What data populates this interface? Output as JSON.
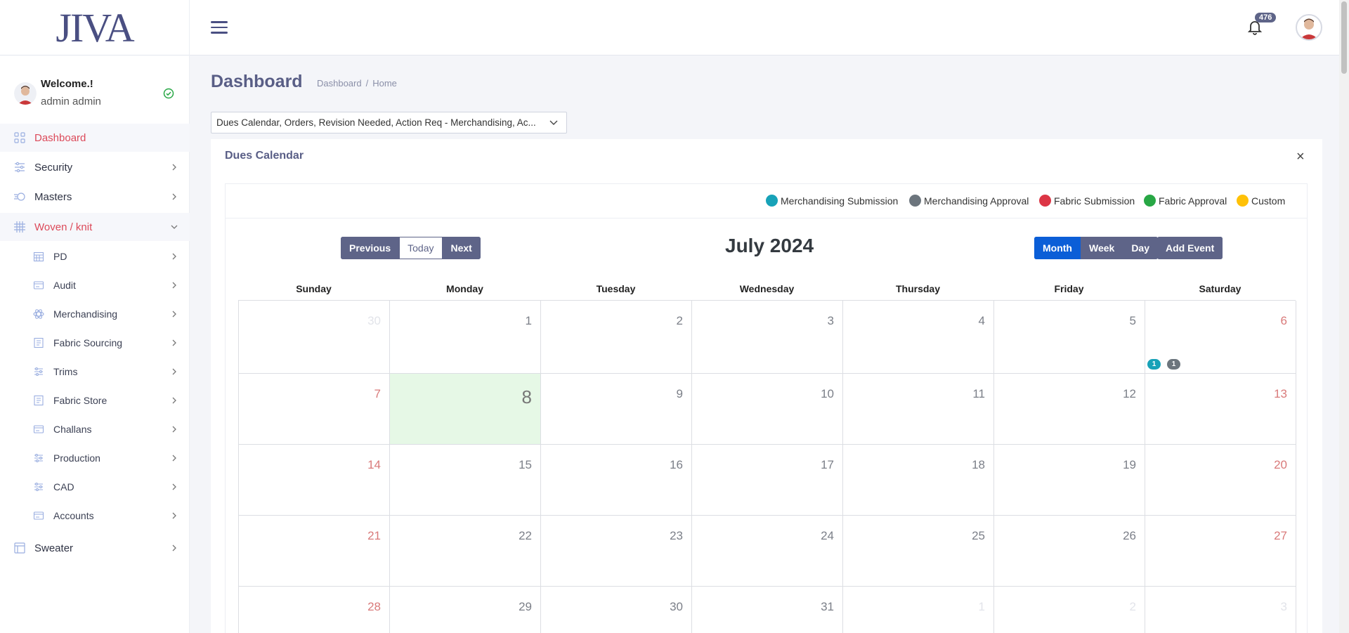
{
  "app": {
    "logo_text": "JIVA",
    "notifications_count": "476"
  },
  "sidebar": {
    "welcome": "Welcome.!",
    "user_name": "admin admin",
    "items": [
      {
        "label": "Dashboard",
        "icon": "grid-icon"
      },
      {
        "label": "Security",
        "icon": "sliders-icon"
      },
      {
        "label": "Masters",
        "icon": "speed-icon"
      },
      {
        "label": "Woven / knit",
        "icon": "hash-icon"
      },
      {
        "label": "Sweater",
        "icon": "layout-icon"
      }
    ],
    "sub_items": [
      {
        "label": "PD",
        "icon": "calendar-icon"
      },
      {
        "label": "Audit",
        "icon": "card-icon"
      },
      {
        "label": "Merchandising",
        "icon": "atom-icon"
      },
      {
        "label": "Fabric Sourcing",
        "icon": "document-icon"
      },
      {
        "label": "Trims",
        "icon": "sliders-icon"
      },
      {
        "label": "Fabric Store",
        "icon": "document-icon"
      },
      {
        "label": "Challans",
        "icon": "card-icon"
      },
      {
        "label": "Production",
        "icon": "sliders-icon"
      },
      {
        "label": "CAD",
        "icon": "sliders-icon"
      },
      {
        "label": "Accounts",
        "icon": "card-icon"
      }
    ]
  },
  "page": {
    "title": "Dashboard",
    "breadcrumb": [
      "Dashboard",
      "Home"
    ],
    "widget_select": "Dues Calendar, Orders, Revision Needed, Action Req - Merchandising, Ac..."
  },
  "card": {
    "title": "Dues Calendar",
    "close": "×"
  },
  "legend": [
    {
      "label": "Merchandising Submission",
      "color": "#17a2b8"
    },
    {
      "label": "Merchandising Approval",
      "color": "#6c757d"
    },
    {
      "label": "Fabric Submission",
      "color": "#dc3545"
    },
    {
      "label": "Fabric Approval",
      "color": "#28a745"
    },
    {
      "label": "Custom",
      "color": "#ffc107"
    }
  ],
  "calendar": {
    "nav": [
      "Previous",
      "Today",
      "Next"
    ],
    "views": [
      "Month",
      "Week",
      "Day"
    ],
    "add_event": "Add Event",
    "month_title": "July 2024",
    "weekdays": [
      "Sunday",
      "Monday",
      "Tuesday",
      "Wednesday",
      "Thursday",
      "Friday",
      "Saturday"
    ],
    "weeks": [
      [
        "30",
        "1",
        "2",
        "3",
        "4",
        "5",
        "6"
      ],
      [
        "7",
        "8",
        "9",
        "10",
        "11",
        "12",
        "13"
      ],
      [
        "14",
        "15",
        "16",
        "17",
        "18",
        "19",
        "20"
      ],
      [
        "21",
        "22",
        "23",
        "24",
        "25",
        "26",
        "27"
      ],
      [
        "28",
        "29",
        "30",
        "31",
        "1",
        "2",
        "3"
      ]
    ],
    "events_on_6": [
      {
        "count": "1",
        "color": "#17a2b8"
      },
      {
        "count": "1",
        "color": "#6c757d"
      }
    ]
  }
}
